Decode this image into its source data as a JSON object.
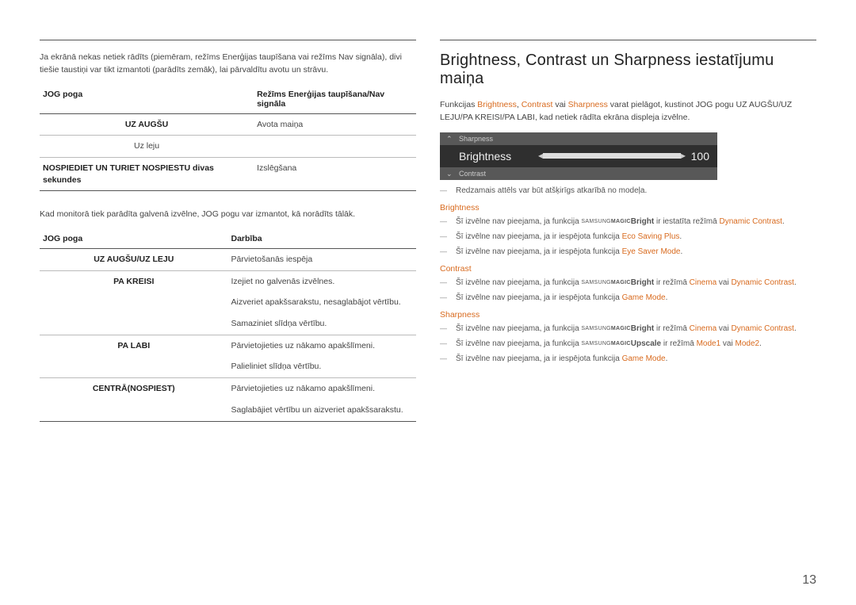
{
  "left": {
    "intro": "Ja ekrānā nekas netiek rādīts (piemēram, režīms Enerģijas taupīšana vai režīms Nav signāla), divi tiešie taustiņi var tikt izmantoti (parādīts zemāk), lai pārvaldītu avotu un strāvu.",
    "t1_h1": "JOG poga",
    "t1_h2": "Režīms Enerģijas taupīšana/Nav signāla",
    "t1_r1c1": "UZ AUGŠU",
    "t1_r1c2": "Avota maiņa",
    "t1_r2c1": "Uz leju",
    "t1_r3c1": "NOSPIEDIET UN TURIET NOSPIESTU divas sekundes",
    "t1_r3c2": "Izslēgšana",
    "mid": "Kad monitorā tiek parādīta galvenā izvēlne, JOG pogu var izmantot, kā norādīts tālāk.",
    "t2_h1": "JOG poga",
    "t2_h2": "Darbība",
    "t2_r1c1": "UZ AUGŠU/UZ LEJU",
    "t2_r1c2": "Pārvietošanās iespēja",
    "t2_r2c1": "PA KREISI",
    "t2_r2c2a": "Izejiet no galvenās izvēlnes.",
    "t2_r2c2b": "Aizveriet apakšsarakstu, nesaglabājot vērtību.",
    "t2_r2c2c": "Samaziniet slīdņa vērtību.",
    "t2_r3c1": "PA LABI",
    "t2_r3c2a": "Pārvietojieties uz nākamo apakšlīmeni.",
    "t2_r3c2b": "Palieliniet slīdņa vērtību.",
    "t2_r4c1": "CENTRĀ(NOSPIEST)",
    "t2_r4c2a": "Pārvietojieties uz nākamo apakšlīmeni.",
    "t2_r4c2b": "Saglabājiet vērtību un aizveriet apakšsarakstu."
  },
  "right": {
    "heading": "Brightness, Contrast un Sharpness iestatījumu maiņa",
    "intro_a": "Funkcijas ",
    "intro_b1": "Brightness",
    "intro_c": ", ",
    "intro_b2": "Contrast",
    "intro_d": " vai ",
    "intro_b3": "Sharpness",
    "intro_e": " varat pielāgot, kustinot JOG pogu UZ AUGŠU/UZ LEJU/PA KREISI/PA LABI, kad netiek rādīta ekrāna displeja izvēlne.",
    "osd_up": "Sharpness",
    "osd_label": "Brightness",
    "osd_val": "100",
    "osd_down": "Contrast",
    "disclaimer": "Redzamais attēls var būt atšķirīgs atkarībā no modeļa.",
    "sec1": "Brightness",
    "n1a_a": "Šī izvēlne nav pieejama, ja funkcija ",
    "magic_bright": "Bright",
    "n1a_b": " ir iestatīta režīmā ",
    "n1a_c": "Dynamic Contrast",
    "n1b_a": "Šī izvēlne nav pieejama, ja ir iespējota funkcija ",
    "n1b_b": "Eco Saving Plus",
    "n1c_a": "Šī izvēlne nav pieejama, ja ir iespējota funkcija ",
    "n1c_b": "Eye Saver Mode",
    "sec2": "Contrast",
    "n2a_a": "Šī izvēlne nav pieejama, ja funkcija ",
    "n2a_b": " ir režīmā ",
    "n2a_c": "Cinema",
    "n2a_d": " vai ",
    "n2a_e": "Dynamic Contrast",
    "n2b_a": "Šī izvēlne nav pieejama, ja ir iespējota funkcija ",
    "n2b_b": "Game Mode",
    "sec3": "Sharpness",
    "n3a_a": "Šī izvēlne nav pieejama, ja funkcija ",
    "n3a_b": " ir režīmā ",
    "n3a_c": "Cinema",
    "n3a_d": " vai ",
    "n3a_e": "Dynamic Contrast",
    "n3b_a": "Šī izvēlne nav pieejama, ja funkcija ",
    "magic_upscale": "Upscale",
    "n3b_b": " ir režīmā ",
    "n3b_c": "Mode1",
    "n3b_d": " vai ",
    "n3b_e": "Mode2",
    "n3c_a": "Šī izvēlne nav pieejama, ja ir iespējota funkcija ",
    "n3c_b": "Game Mode",
    "samsung": "SAMSUNG",
    "magic": "MAGIC",
    "dot": "."
  },
  "pagenum": "13"
}
